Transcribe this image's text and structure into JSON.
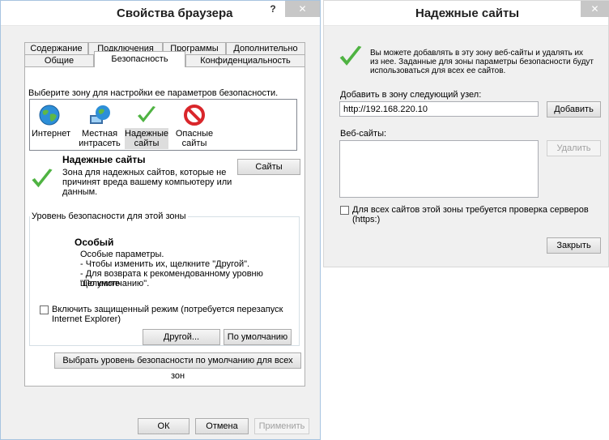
{
  "left_dialog": {
    "title": "Свойства браузера",
    "help": "?",
    "close": "✕",
    "tabs_row1": [
      "Содержание",
      "Подключения",
      "Программы",
      "Дополнительно"
    ],
    "tabs_row2": [
      "Общие",
      "Безопасность",
      "Конфиденциальность"
    ],
    "zone_prompt": "Выберите зону для настройки ее параметров безопасности.",
    "zones": [
      {
        "label_line1": "Интернет",
        "label_line2": "",
        "icon": "globe-icon"
      },
      {
        "label_line1": "Местная",
        "label_line2": "интрасеть",
        "icon": "intranet-icon"
      },
      {
        "label_line1": "Надежные",
        "label_line2": "сайты",
        "icon": "checkmark-icon"
      },
      {
        "label_line1": "Опасные",
        "label_line2": "сайты",
        "icon": "prohibited-icon"
      }
    ],
    "zone_title": "Надежные сайты",
    "zone_desc_line1": "Зона для надежных сайтов, которые не",
    "zone_desc_line2": "причинят вреда вашему компьютеру или",
    "zone_desc_line3": "данным.",
    "sites_button": "Сайты",
    "level_group": "Уровень безопасности для этой зоны",
    "level_title": "Особый",
    "level_line1": "Особые параметры.",
    "level_line2": "- Чтобы изменить их, щелкните \"Другой\".",
    "level_line3": "- Для возврата к рекомендованному уровню щелкните",
    "level_line4": "\"По умолчанию\".",
    "protected_mode_line1": "Включить защищенный режим (потребуется перезапуск",
    "protected_mode_line2": "Internet Explorer)",
    "other_button": "Другой...",
    "default_button": "По умолчанию",
    "reset_all_button": "Выбрать уровень безопасности по умолчанию для всех зон",
    "ok_button": "ОК",
    "cancel_button": "Отмена",
    "apply_button": "Применить"
  },
  "right_dialog": {
    "title": "Надежные сайты",
    "close": "✕",
    "info_line1": "Вы можете добавлять в эту зону  веб-сайты и удалять их",
    "info_line2": "из нее. Заданные для зоны параметры безопасности будут",
    "info_line3": "использоваться для всех ее сайтов.",
    "add_label": "Добавить в зону следующий узел:",
    "add_value": "http://192.168.220.10",
    "add_button": "Добавить",
    "sites_label": "Веб-сайты:",
    "remove_button": "Удалить",
    "https_check": "Для всех сайтов этой зоны требуется проверка серверов (https:)",
    "close_button": "Закрыть"
  }
}
